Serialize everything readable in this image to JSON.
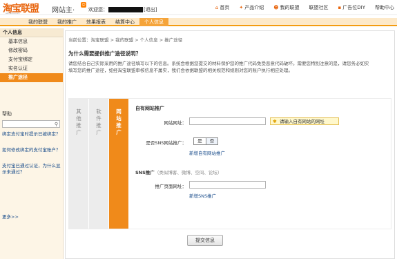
{
  "header": {
    "logo_text": "淘宝联盟",
    "logo_sub": "alimama.com",
    "site_title": "网站主·",
    "badge": "☺",
    "welcome": "欢迎您：",
    "logout": "[退出]",
    "links": [
      {
        "icon": "home-icon",
        "glyph": "⌂",
        "label": "首页"
      },
      {
        "icon": "product-icon",
        "glyph": "✦",
        "label": "产品介绍"
      },
      {
        "icon": "user-icon",
        "glyph": "☻",
        "label": "我的联盟"
      },
      {
        "icon": "",
        "glyph": "",
        "label": "联盟社区"
      },
      {
        "icon": "ad-icon",
        "glyph": "▪",
        "label": "广告位DIY"
      },
      {
        "icon": "",
        "glyph": "",
        "label": "帮助中心"
      }
    ]
  },
  "nav": {
    "items": [
      "我的联盟",
      "我的推广",
      "效果报表",
      "结算中心",
      "个人信息"
    ],
    "active": "个人信息"
  },
  "sidebar": {
    "heading": "个人信息",
    "items": [
      "基本信息",
      "修改密码",
      "支付宝绑定",
      "实名认证",
      "推广途径"
    ],
    "active": "推广途径",
    "help_heading": "帮助",
    "help_links": [
      "绑定支付宝时提示已被绑定？",
      "如何修改绑定的支付宝账户？",
      "支付宝已通过认证，为什么显示未通过？"
    ],
    "more": "更多>>"
  },
  "main": {
    "breadcrumb": "当前位置：淘宝联盟 > 我的联盟 > 个人信息 > 推广途径",
    "question": "为什么需要提供推广途径说明？",
    "explain": "请您结合自己实际采用的推广途径填写以下的信息。系统会根据您提交的材料保护您的推广代码免受恶意代码破坏。需要您特别注意的是，请您务必如实填写您的推广途径，如经淘宝联盟审核信息不属实，我们会依据联盟的相关规范和规则对您的账户执行相应处理。",
    "tabs": [
      {
        "label": [
          "其",
          "他",
          "推",
          "广"
        ]
      },
      {
        "label": [
          "软",
          "件",
          "推",
          "广"
        ]
      },
      {
        "label": [
          "网",
          "站",
          "推",
          "广"
        ]
      }
    ],
    "form": {
      "heading": "自有网站推广",
      "site_url_label": "网站网址：",
      "site_url_value": "",
      "hint": "请输入自有网站的网址",
      "sns_question": "是否SNS网站推广：",
      "yes": "是",
      "no": "否",
      "add_site_link": "新增自有网站推广",
      "sns_title": "SNS推广",
      "sns_note": "（类似博客、微博、空间、论坛）",
      "page_url_label": "推广页面网址：",
      "page_url_value": "",
      "add_sns_link": "新增SNS推广"
    },
    "submit": "提交信息"
  },
  "colors": {
    "accent": "#f08a1a",
    "nav_bg": "#fde9c9",
    "link": "#1b4e8c"
  }
}
